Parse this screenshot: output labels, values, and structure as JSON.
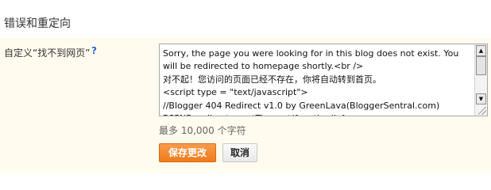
{
  "section": {
    "title": "错误和重定向"
  },
  "field": {
    "label": "自定义“找不到网页”",
    "help": "?",
    "value": "Sorry, the page you were looking for in this blog does not exist. You will be redirected to homepage shortly.<br />\n对不起！您访问的页面已经不存在，你将自动转到首页。\n<script type = \"text/javascript\">\n//Blogger 404 Redirect v1.0 by GreenLava(BloggerSentral.com)\nBSPNF_redirect = setTimeout(function() {",
    "char_limit": "最多 10,000 个字符"
  },
  "actions": {
    "save": "保存更改",
    "cancel": "取消"
  },
  "colors": {
    "panel_bg": "#fffbee",
    "save_btn": "#f48a2e",
    "help_link": "#2a66c9"
  },
  "icons": {
    "scroll_up": "▲",
    "scroll_down": "▼"
  }
}
